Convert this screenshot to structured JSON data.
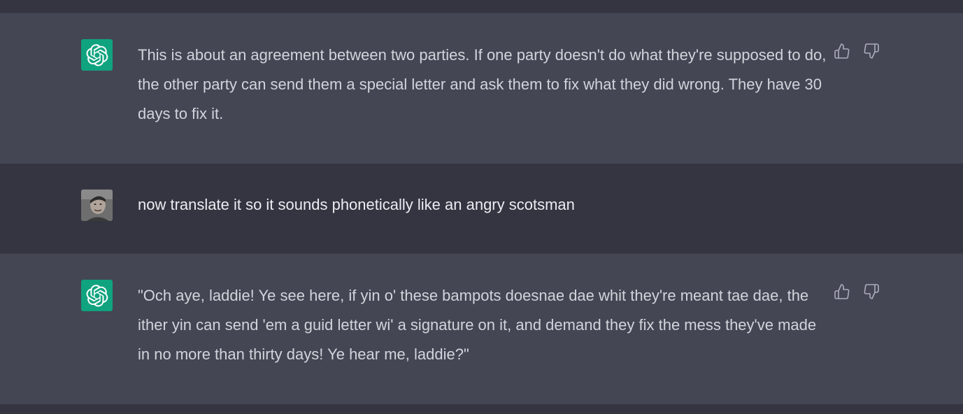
{
  "conversation": {
    "messages": [
      {
        "role": "assistant",
        "avatar_icon": "openai-logo-icon",
        "text": "This is about an agreement between two parties. If one party doesn't do what they're supposed to do, the other party can send them a special letter and ask them to fix what they did wrong. They have 30 days to fix it."
      },
      {
        "role": "user",
        "avatar_icon": "user-photo",
        "text": "now translate it so it sounds phonetically like an angry scotsman"
      },
      {
        "role": "assistant",
        "avatar_icon": "openai-logo-icon",
        "text": "\"Och aye, laddie! Ye see here, if yin o' these bampots doesnae dae whit they're meant tae dae, the ither yin can send 'em a guid letter wi' a signature on it, and demand they fix the mess they've made in no more than thirty days! Ye hear me, laddie?\""
      }
    ]
  },
  "feedback_icons": [
    "thumbs-up-icon",
    "thumbs-down-icon"
  ],
  "colors": {
    "page_bg": "#343541",
    "assistant_bg": "#444654",
    "brand_green": "#10a37f",
    "text": "#d1d5db",
    "icon": "#acacbe"
  }
}
